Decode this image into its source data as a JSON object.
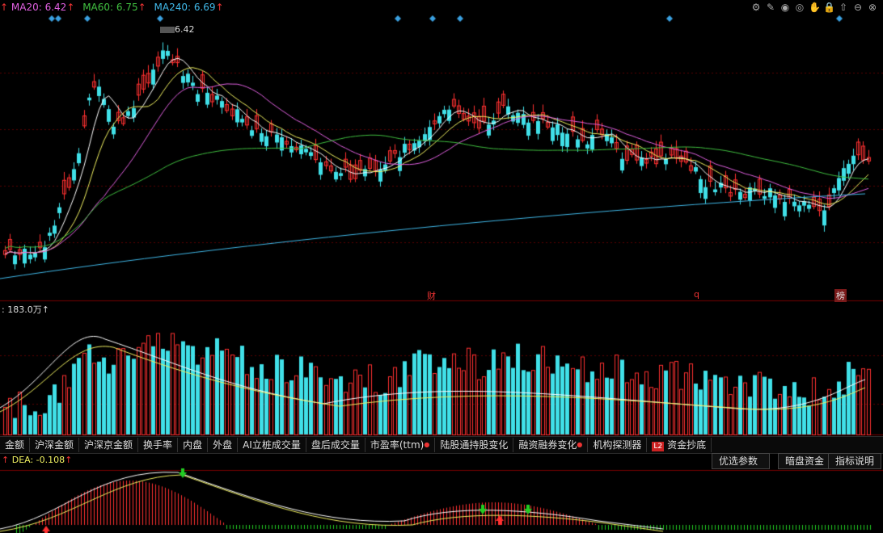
{
  "ma_legend": [
    {
      "label": "MA20: 6.42",
      "arrow": "↑",
      "color": "#e060e0"
    },
    {
      "label": "MA60: 6.75",
      "arrow": "↑",
      "color": "#40c040"
    },
    {
      "label": "MA240: 6.69",
      "arrow": "↑",
      "color": "#40b8e8"
    }
  ],
  "peak_value": "6.42",
  "volume_label": ": 183.0万↑",
  "events": [
    {
      "text": "财"
    },
    {
      "text": "q"
    },
    {
      "text": "榜"
    }
  ],
  "tabs": [
    {
      "label": "金额",
      "dot": false
    },
    {
      "label": "沪深金额",
      "dot": false
    },
    {
      "label": "沪深京金额",
      "dot": false
    },
    {
      "label": "换手率",
      "dot": false
    },
    {
      "label": "内盘",
      "dot": false
    },
    {
      "label": "外盘",
      "dot": false
    },
    {
      "label": "AI立桩成交量",
      "dot": false
    },
    {
      "label": "盘后成交量",
      "dot": false
    },
    {
      "label": "市盈率(ttm)",
      "dot": true
    },
    {
      "label": "陆股通持股变化",
      "dot": false
    },
    {
      "label": "融资融券变化",
      "dot": true
    },
    {
      "label": "机构探测器",
      "dot": false
    },
    {
      "label": "资金抄底",
      "dot": false,
      "l2": "L2"
    }
  ],
  "right_buttons": {
    "params": "优选参数",
    "dark_pool": "暗盘资金",
    "help": "指标说明"
  },
  "dea_label": "DEA: -0.108",
  "dea_arrow": "↑",
  "colors": {
    "up": "#ff3030",
    "down": "#40e0e8",
    "ma5": "#ffffff",
    "ma10": "#f0f060"
  }
}
